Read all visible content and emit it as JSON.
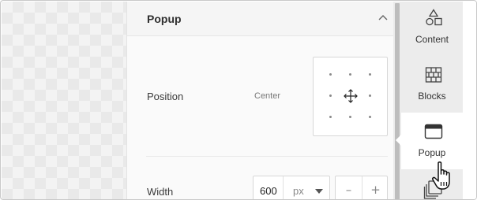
{
  "panel": {
    "title": "Popup",
    "position": {
      "label": "Position",
      "value": "Center"
    },
    "width": {
      "label": "Width",
      "value": "600",
      "unit": "px",
      "decrement": "–",
      "increment": "+"
    }
  },
  "sidebar": {
    "items": [
      {
        "label": "Content",
        "icon": "shapes-icon",
        "active": false
      },
      {
        "label": "Blocks",
        "icon": "blocks-icon",
        "active": false
      },
      {
        "label": "Popup",
        "icon": "popup-window-icon",
        "active": true
      }
    ]
  },
  "colors": {
    "panel_bg": "#fafafa",
    "sidebar_bg": "#ececec",
    "active_bg": "#ffffff"
  }
}
